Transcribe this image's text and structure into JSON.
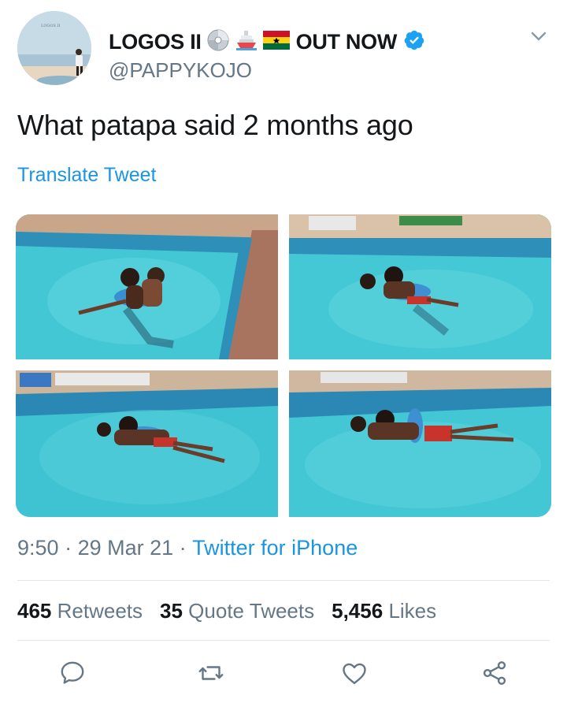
{
  "tweet": {
    "display_name": "LOGOS II",
    "name_suffix": "OUT NOW",
    "handle": "@PAPPYKOJO",
    "avatar_label": "LOGOS II",
    "text": "What patapa said 2 months ago",
    "translate_label": "Translate Tweet",
    "time": "9:50",
    "date": "29 Mar 21",
    "source": "Twitter for iPhone",
    "separator": " · "
  },
  "stats": {
    "retweets_count": "465",
    "retweets_label": "Retweets",
    "quotes_count": "35",
    "quotes_label": "Quote Tweets",
    "likes_count": "5,456",
    "likes_label": "Likes"
  },
  "icons": {
    "verified": "verified-badge-icon",
    "chevron": "chevron-down-icon",
    "reply": "reply-icon",
    "retweet": "retweet-icon",
    "like": "heart-icon",
    "share": "share-icon",
    "emoji_1": "cd-disc-icon",
    "emoji_2": "ship-icon",
    "emoji_3": "ghana-flag-icon"
  },
  "colors": {
    "accent": "#1b95e0",
    "text": "#14171a",
    "muted": "#657786",
    "verified": "#1da1f2"
  }
}
